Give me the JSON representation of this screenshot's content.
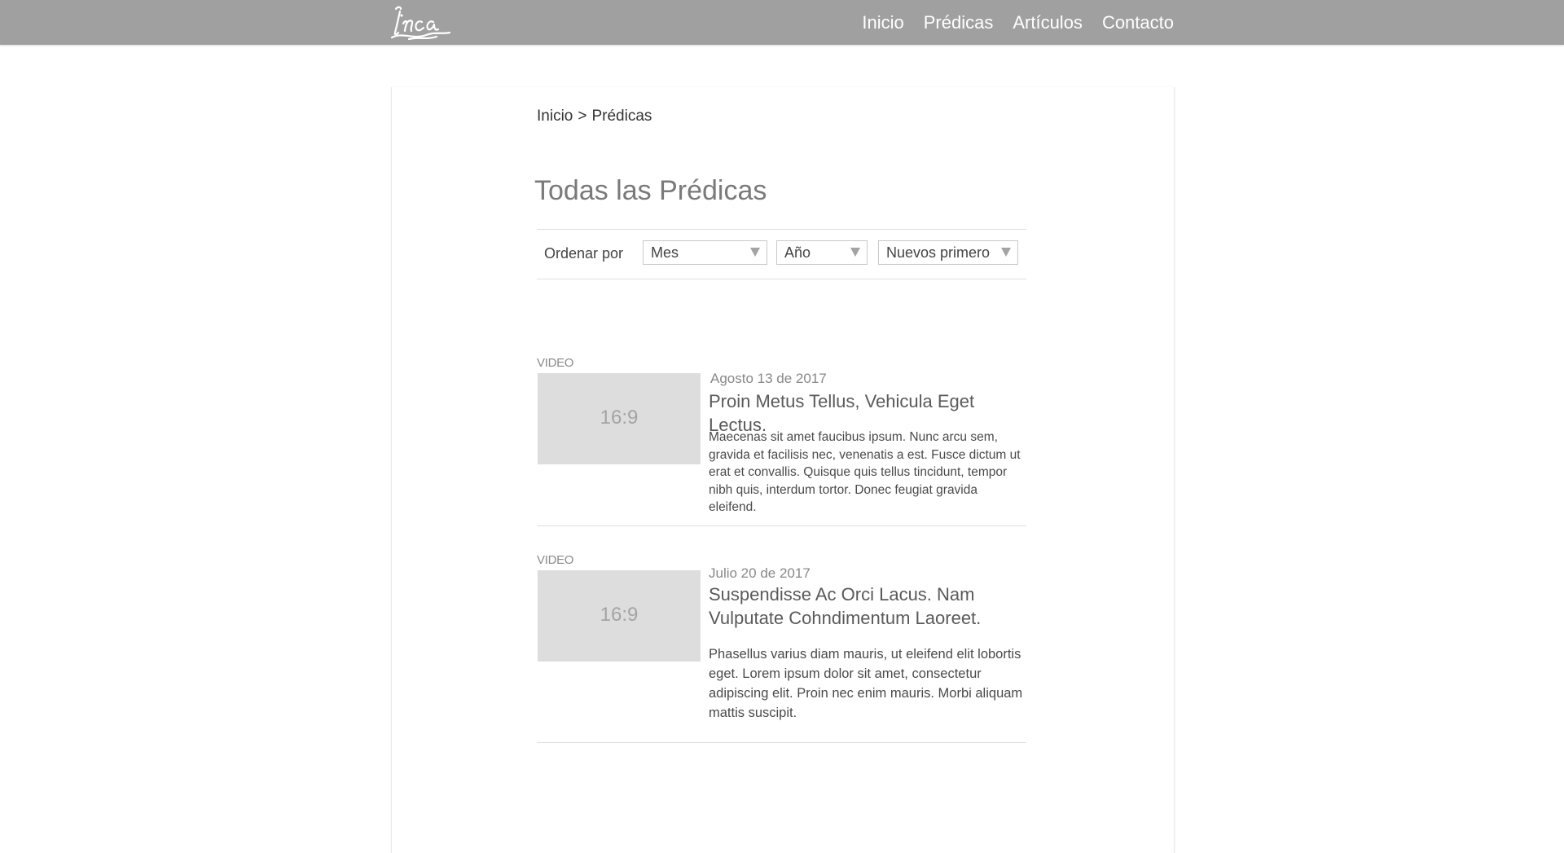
{
  "header": {
    "logo_icon": "inca-script-logo",
    "nav": [
      {
        "label": "Inicio"
      },
      {
        "label": "Prédicas"
      },
      {
        "label": "Artículos"
      },
      {
        "label": "Contacto"
      }
    ],
    "background_color": "#a0a0a0"
  },
  "breadcrumb": {
    "home": "Inicio",
    "separator": ">",
    "current": "Prédicas"
  },
  "page_title": "Todas las Prédicas",
  "filters": {
    "label": "Ordenar por",
    "month": {
      "value": "Mes"
    },
    "year": {
      "value": "Año"
    },
    "order": {
      "value": "Nuevos primero"
    }
  },
  "items": [
    {
      "type": "VIDEO",
      "thumbnail_text": "16:9",
      "date": "Agosto 13 de 2017",
      "title": "Proin Metus Tellus, Vehicula Eget Lectus.",
      "description": "Maecenas sit amet faucibus ipsum. Nunc arcu sem, gravida et facilisis nec, venenatis a est. Fusce dictum ut erat et convallis. Quisque quis tellus tincidunt, tempor nibh quis, interdum tortor. Donec feugiat gravida eleifend."
    },
    {
      "type": "VIDEO",
      "thumbnail_text": "16:9",
      "date": "Julio 20 de 2017",
      "title": "Suspendisse Ac Orci Lacus. Nam Vulputate Cohndimentum Laoreet.",
      "description": "Phasellus varius diam mauris, ut eleifend elit lobortis eget. Lorem ipsum dolor sit amet, consectetur adipiscing elit. Proin nec enim mauris. Morbi aliquam mattis suscipit."
    }
  ]
}
